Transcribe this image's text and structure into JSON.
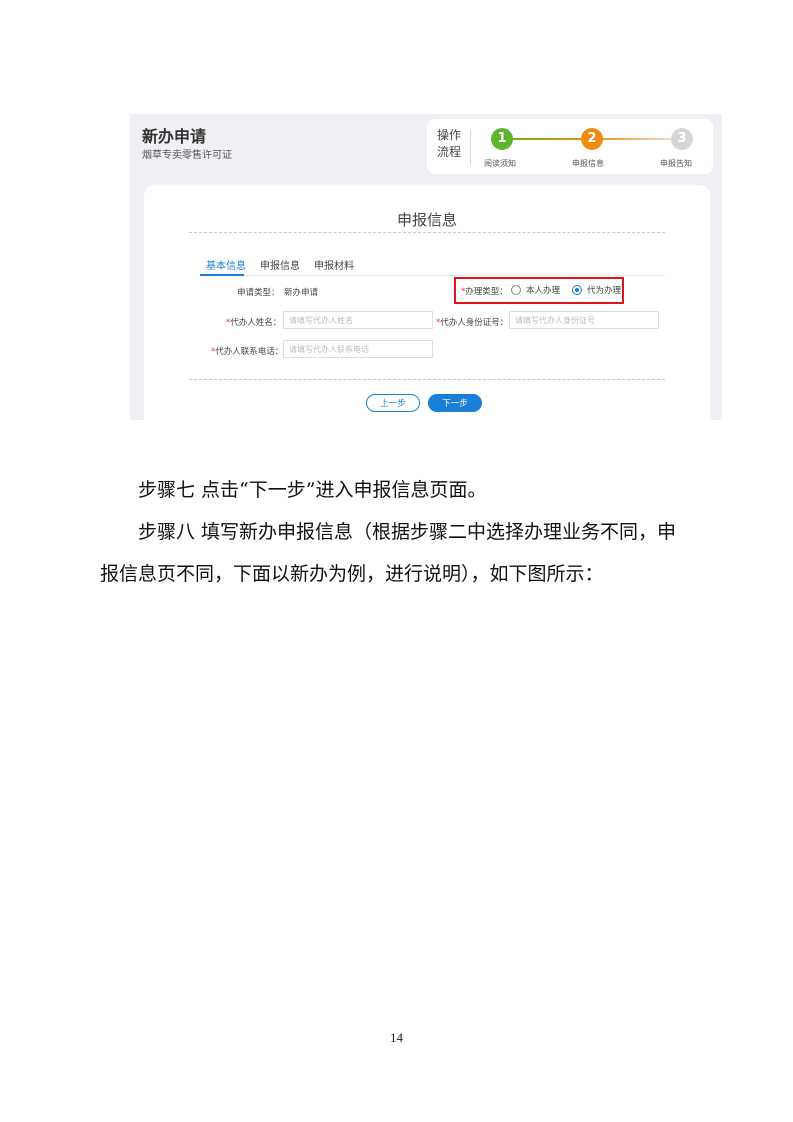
{
  "screenshot": {
    "app_title": "新办申请",
    "app_subtitle": "烟草专卖零售许可证",
    "process": {
      "label": "操作流程",
      "steps": [
        {
          "number": "1",
          "label": "阅读须知",
          "color": "#5db52e"
        },
        {
          "number": "2",
          "label": "申报信息",
          "color": "#f08a13"
        },
        {
          "number": "3",
          "label": "申报告知",
          "color": "#d6d6d6"
        }
      ]
    },
    "panel_title": "申报信息",
    "tabs": [
      "基本信息",
      "申报信息",
      "申报材料"
    ],
    "form": {
      "apply_type_label": "申请类型：",
      "apply_type_value": "新办申请",
      "handle_type_label": "办理类型：",
      "handle_options": [
        {
          "label": "本人办理",
          "checked": false
        },
        {
          "label": "代为办理",
          "checked": true
        }
      ],
      "agent_name_label": "代办人姓名：",
      "agent_name_placeholder": "请填写代办人姓名",
      "agent_id_label": "代办人身份证号：",
      "agent_id_placeholder": "请填写代办人身份证号",
      "agent_phone_label": "代办人联系电话：",
      "agent_phone_placeholder": "请填写代办人联系电话",
      "required_mark": "*"
    },
    "buttons": {
      "prev": "上一步",
      "next": "下一步"
    },
    "colors": {
      "accent": "#1a7fd6",
      "highlight_box": "#e0141c"
    }
  },
  "doc": {
    "step7": "步骤七  点击“下一步”进入申报信息页面。",
    "step8_line1": "步骤八  填写新办申报信息（根据步骤二中选择办理业务不同，申",
    "step8_line2": "报信息页不同，下面以新办为例，进行说明），如下图所示：",
    "page_number": "14"
  }
}
